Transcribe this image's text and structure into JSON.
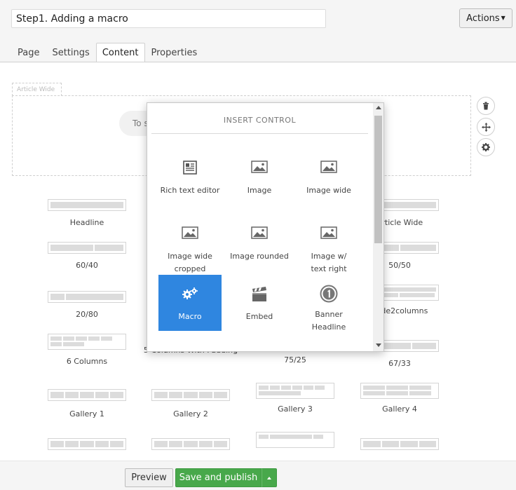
{
  "header": {
    "name_value": "Step1. Adding a macro",
    "actions_label": "Actions"
  },
  "tabs": [
    {
      "label": "Page"
    },
    {
      "label": "Settings"
    },
    {
      "label": "Content",
      "active": true
    },
    {
      "label": "Properties"
    }
  ],
  "grid": {
    "area_label": "Article Wide",
    "placeholder_text": "To s"
  },
  "layouts": [
    {
      "label": "Headline"
    },
    {
      "label": "Article Wide"
    },
    {
      "label": "60/40"
    },
    {
      "label": "50/50"
    },
    {
      "label": "20/80"
    },
    {
      "label": "Wide2columns"
    },
    {
      "label": "6 Columns"
    },
    {
      "label": "5 Columns With Padding"
    },
    {
      "label": "75/25"
    },
    {
      "label": "67/33"
    },
    {
      "label": "Gallery 1"
    },
    {
      "label": "Gallery 2"
    },
    {
      "label": "Gallery 3"
    },
    {
      "label": "Gallery 4"
    }
  ],
  "insert_control": {
    "title": "INSERT CONTROL",
    "items": [
      {
        "label": "Rich text editor",
        "icon": "rich-text-icon"
      },
      {
        "label": "Image",
        "icon": "image-icon"
      },
      {
        "label": "Image wide",
        "icon": "image-icon"
      },
      {
        "label": "Image wide cropped",
        "icon": "image-icon"
      },
      {
        "label": "Image rounded",
        "icon": "image-icon"
      },
      {
        "label": "Image w/ text right",
        "icon": "image-icon"
      },
      {
        "label": "Macro",
        "icon": "gears-icon",
        "selected": true
      },
      {
        "label": "Embed",
        "icon": "clapperboard-icon"
      },
      {
        "label": "Banner Headline",
        "icon": "numbered-circle-icon"
      }
    ],
    "accent_color": "#2f86e0"
  },
  "footer": {
    "preview_label": "Preview",
    "save_label": "Save and publish",
    "save_color": "#48a84b"
  }
}
